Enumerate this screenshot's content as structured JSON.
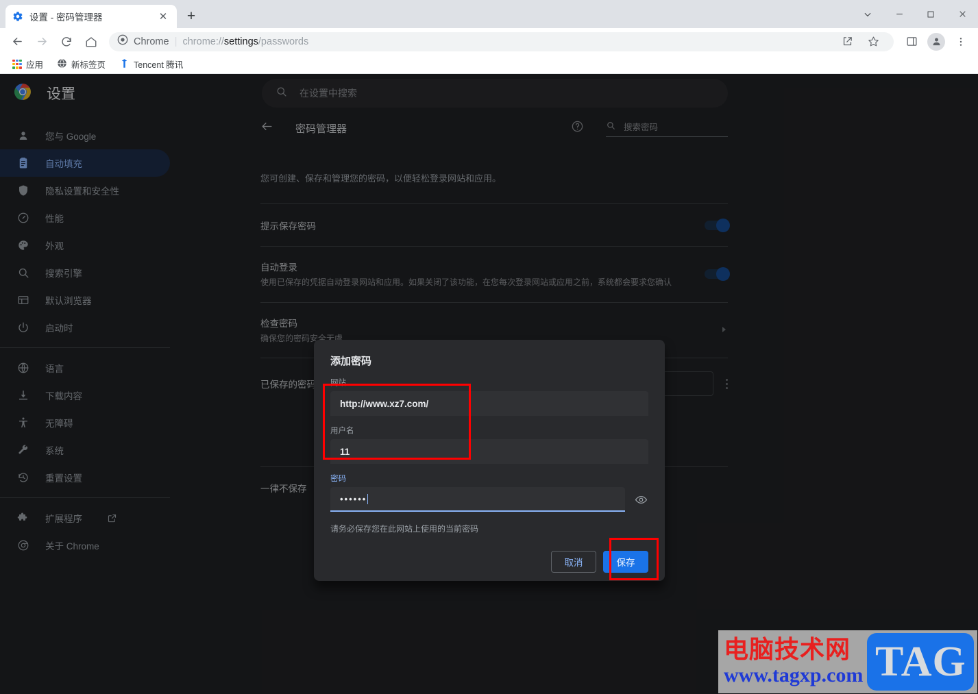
{
  "window": {
    "tab": {
      "title": "设置 - 密码管理器",
      "favicon": "settings-gear-icon",
      "close": "✕"
    },
    "new_tab": "+",
    "controls": {
      "tab_search": "⌄",
      "minimize": "—",
      "maximize": "□",
      "close": "✕"
    }
  },
  "toolbar": {
    "back": "←",
    "forward": "→",
    "reload": "⟳",
    "home": "⌂",
    "omnibox": {
      "scheme_label": "Chrome",
      "separator": "|",
      "url_prefix": "chrome://",
      "url_bold": "settings",
      "url_suffix": "/passwords"
    },
    "share": "share-icon",
    "bookmark": "star-icon",
    "side_panel": "side-panel-icon",
    "profile": "avatar-icon",
    "menu": "three-dot-menu-icon"
  },
  "bookmarks_bar": {
    "items": [
      {
        "label": "应用",
        "icon": "apps-grid-icon"
      },
      {
        "label": "新标签页",
        "icon": "globe-icon"
      },
      {
        "label": "Tencent 腾讯",
        "icon": "tencent-icon"
      }
    ]
  },
  "settings": {
    "brand": "设置",
    "search_placeholder": "在设置中搜索",
    "sidebar": [
      {
        "label": "您与 Google",
        "icon": "person-icon",
        "active": false
      },
      {
        "label": "自动填充",
        "icon": "autofill-clipboard-icon",
        "active": true
      },
      {
        "label": "隐私设置和安全性",
        "icon": "shield-icon",
        "active": false
      },
      {
        "label": "性能",
        "icon": "speedometer-icon",
        "active": false
      },
      {
        "label": "外观",
        "icon": "palette-icon",
        "active": false
      },
      {
        "label": "搜索引擎",
        "icon": "search-icon",
        "active": false
      },
      {
        "label": "默认浏览器",
        "icon": "browser-window-icon",
        "active": false
      },
      {
        "label": "启动时",
        "icon": "power-icon",
        "active": false
      }
    ],
    "sidebar_group2": [
      {
        "label": "语言",
        "icon": "globe-icon"
      },
      {
        "label": "下载内容",
        "icon": "download-icon"
      },
      {
        "label": "无障碍",
        "icon": "accessibility-icon"
      },
      {
        "label": "系统",
        "icon": "wrench-icon"
      },
      {
        "label": "重置设置",
        "icon": "history-restore-icon"
      }
    ],
    "sidebar_group3": [
      {
        "label": "扩展程序",
        "icon": "puzzle-icon",
        "external": "open-in-new-icon"
      },
      {
        "label": "关于 Chrome",
        "icon": "chrome-logo-icon"
      }
    ]
  },
  "password_manager": {
    "back_arrow": "←",
    "title": "密码管理器",
    "help_icon": "help-circle-icon",
    "search_icon": "search-icon",
    "search_placeholder": "搜索密码",
    "description": "您可创建、保存和管理您的密码，以便轻松登录网站和应用。",
    "rows": [
      {
        "label": "提示保存密码",
        "sub": "",
        "control": "toggle",
        "on": true
      },
      {
        "label": "自动登录",
        "sub": "使用已保存的凭据自动登录网站和应用。如果关闭了该功能，在您每次登录网站或应用之前，系统都会要求您确认",
        "control": "toggle",
        "on": true
      },
      {
        "label": "检查密码",
        "sub": "确保您的密码安全无虞",
        "control": "chevron",
        "on": false
      },
      {
        "label": "已保存的密码",
        "sub": "",
        "control": "kebab",
        "on": false
      },
      {
        "label": "一律不保存",
        "sub": "",
        "control": "none",
        "on": false
      }
    ],
    "empty_saved": "已保",
    "empty_never": "一律"
  },
  "dialog": {
    "title": "添加密码",
    "site": {
      "label": "网站",
      "value": "http://www.xz7.com/",
      "focused": false
    },
    "username": {
      "label": "用户名",
      "value": "11",
      "focused": false
    },
    "password": {
      "label": "密码",
      "value": "••••••",
      "focused": true,
      "reveal_icon": "eye-icon"
    },
    "hint": "请务必保存您在此网站上使用的当前密码",
    "cancel_label": "取消",
    "save_label": "保存"
  },
  "annotations": {
    "fields_highlight": "red-rectangle-fields",
    "save_highlight": "red-rectangle-save-button"
  },
  "watermark": {
    "cn_text": "电脑技术网",
    "url_text": "www.tagxp.com",
    "badge_text": "TAG"
  },
  "colors": {
    "accent_blue": "#1a73e8",
    "link_blue": "#8ab4f8",
    "dark_bg": "#202124",
    "dialog_bg": "#292a2d",
    "highlight_red": "#ff0000"
  }
}
